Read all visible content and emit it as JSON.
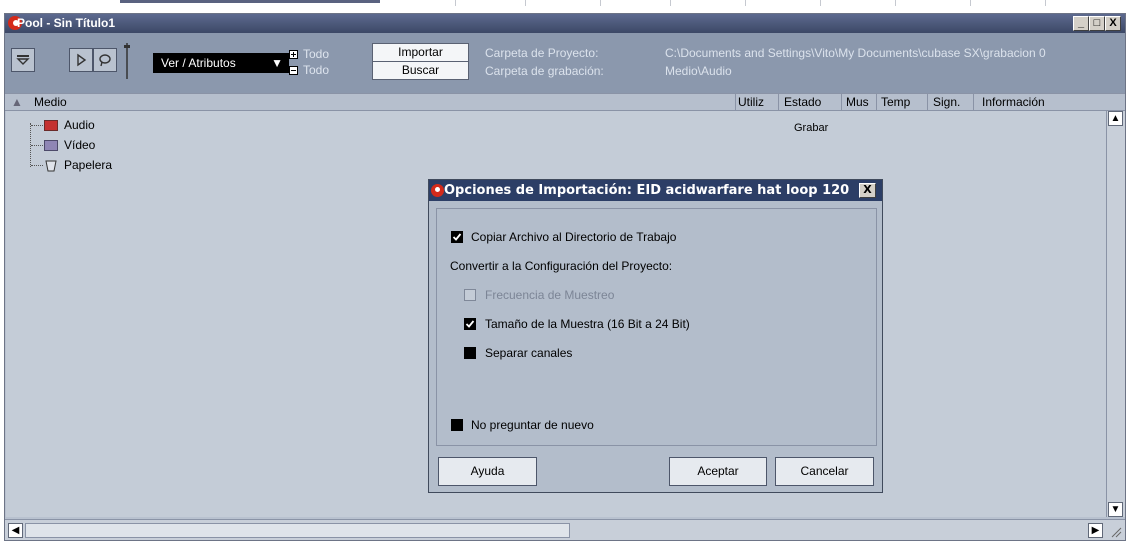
{
  "window": {
    "title": "Pool - Sin Título1",
    "controls": [
      "_",
      "□",
      "X"
    ]
  },
  "toolbar": {
    "view_select": "Ver / Atributos",
    "todo_expand": "Todo",
    "todo_collapse": "Todo",
    "import_button": "Importar",
    "search_button": "Buscar",
    "project_folder_label": "Carpeta de Proyecto:",
    "project_folder_path": "C:\\Documents and Settings\\Vito\\My Documents\\cubase SX\\grabacion 0",
    "record_folder_label": "Carpeta de grabación:",
    "record_folder_path": "Medio\\Audio"
  },
  "columns": [
    "Medio",
    "Utiliz",
    "Estado",
    "Mus",
    "Temp",
    "Sign.",
    "Información"
  ],
  "tree": [
    {
      "label": "Audio",
      "icon": "audio-folder-icon"
    },
    {
      "label": "Vídeo",
      "icon": "video-folder-icon"
    },
    {
      "label": "Papelera",
      "icon": "trash-icon"
    }
  ],
  "status_cell": "Grabar",
  "dialog": {
    "title": "Opciones de Importación: EID acidwarfare hat loop 120",
    "copy_file": {
      "label": "Copiar Archivo al Directorio de Trabajo",
      "checked": true
    },
    "convert_heading": "Convertir a la Configuración del Proyecto:",
    "sample_rate": {
      "label": "Frecuencia de Muestreo",
      "checked": false,
      "disabled": true
    },
    "sample_size": {
      "label": "Tamaño de la Muestra (16 Bit a 24 Bit)",
      "checked": true
    },
    "split_channels": {
      "label": "Separar canales",
      "checked": false
    },
    "dont_ask": {
      "label": "No preguntar de nuevo",
      "checked": false
    },
    "help_button": "Ayuda",
    "accept_button": "Aceptar",
    "cancel_button": "Cancelar"
  }
}
